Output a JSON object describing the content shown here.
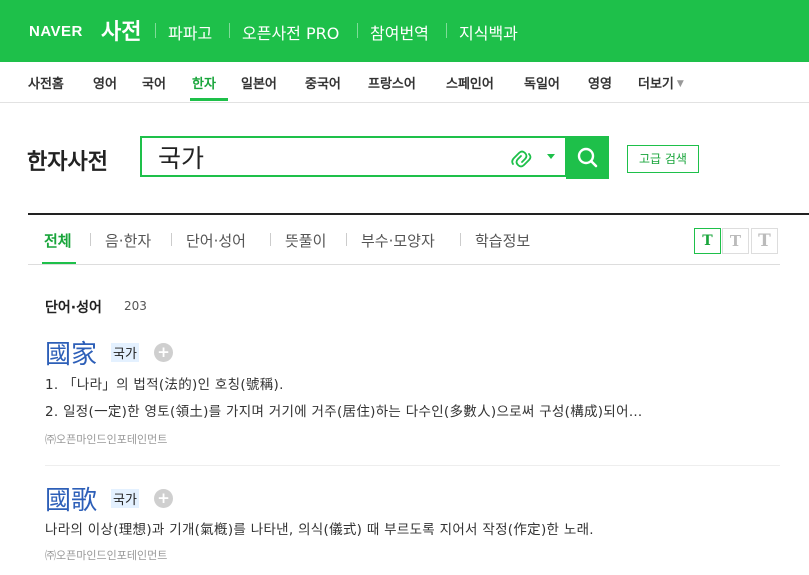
{
  "header": {
    "logo": "NAVER",
    "service": "사전",
    "nav": [
      "파파고",
      "오픈사전 PRO",
      "참여번역",
      "지식백과"
    ]
  },
  "subnav": {
    "items": [
      "사전홈",
      "영어",
      "국어",
      "한자",
      "일본어",
      "중국어",
      "프랑스어",
      "스페인어",
      "독일어",
      "영영",
      "더보기"
    ],
    "active": "한자"
  },
  "search": {
    "dict_title": "한자사전",
    "query": "국가",
    "advanced_label": "고급 검색"
  },
  "filter_tabs": {
    "items": [
      "전체",
      "음·한자",
      "단어·성어",
      "뜻풀이",
      "부수·모양자",
      "학습정보"
    ],
    "active": "전체"
  },
  "text_size": {
    "buttons": [
      "T",
      "T",
      "T"
    ],
    "active_index": 0
  },
  "section": {
    "title": "단어·성어",
    "count": "203",
    "entries": [
      {
        "hanja": "國家",
        "reading": "국가",
        "defs": [
          "1. 「나라」의 법적(法的)인 호칭(號稱).",
          "2. 일정(一定)한 영토(領土)를 가지며 거기에 거주(居住)하는 다수인(多數人)으로써 구성(構成)되어…"
        ],
        "source": "㈜오픈마인드인포테인먼트"
      },
      {
        "hanja": "國歌",
        "reading": "국가",
        "defs": [
          "나라의 이상(理想)과 기개(氣槪)를 나타낸, 의식(儀式) 때 부르도록 지어서 작정(作定)한 노래."
        ],
        "source": "㈜오픈마인드인포테인먼트"
      }
    ]
  },
  "colors": {
    "brand": "#1ec04a",
    "link": "#2d5fb8",
    "active_text": "#19a53b"
  }
}
